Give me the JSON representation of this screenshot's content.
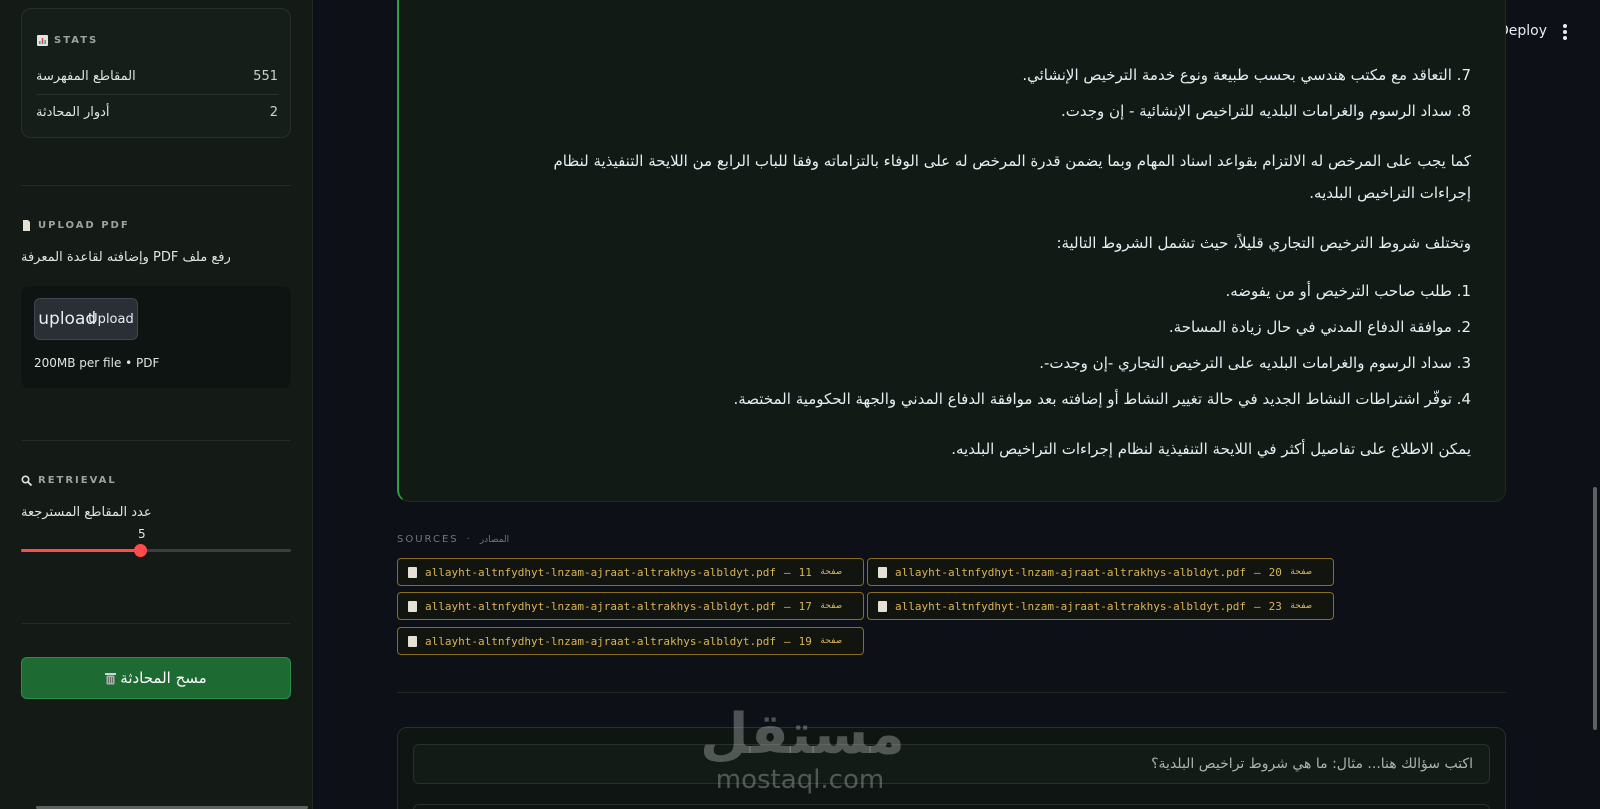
{
  "header": {
    "deploy_label": "Deploy"
  },
  "sidebar": {
    "stats": {
      "title": "STATS",
      "rows": [
        {
          "label": "المقاطع المفهرسة",
          "value": "551"
        },
        {
          "label": "أدوار المحادثة",
          "value": "2"
        }
      ]
    },
    "upload": {
      "title": "UPLOAD PDF",
      "description": "رفع ملف PDF وإضافته لقاعدة المعرفة",
      "button_icon_text": "upload",
      "button_label": "Upload",
      "note": "200MB per file • PDF"
    },
    "retrieval": {
      "title": "RETRIEVAL",
      "slider_label": "عدد المقاطع المسترجعة",
      "slider_value": "5",
      "slider_fraction": 0.44
    },
    "clear_button_label": "مسح المحادثة"
  },
  "message": {
    "lines": [
      "7. التعاقد مع مكتب هندسي بحسب طبيعة ونوع خدمة الترخيص الإنشائي.",
      "8. سداد الرسوم والغرامات البلديه للتراخيص الإنشائية - إن وجدت.",
      "كما يجب على المرخص له الالتزام بقواعد اسناد المهام وبما يضمن قدرة المرخص له على الوفاء بالتزاماته وفقا للباب الرابع من اللايحة التنفيذية لنظام",
      "إجراءات التراخيص البلديه.",
      "وتختلف شروط الترخيص التجاري قليلاً، حيث تشمل الشروط التالية:",
      "1. طلب صاحب الترخيص أو من يفوضه.",
      "2. موافقة الدفاع المدني في حال زيادة المساحة.",
      "3. سداد الرسوم والغرامات البلديه على الترخيص التجاري -إن وجدت-.",
      "4. توفّر اشتراطات النشاط الجديد في حالة تغيير النشاط أو إضافته بعد موافقة الدفاع المدني والجهة الحكومية المختصة.",
      "يمكن الاطلاع على تفاصيل أكثر في اللايحة التنفيذية لنظام إجراءات التراخيص البلديه."
    ]
  },
  "sources": {
    "label": "SOURCES",
    "separator": "·",
    "label_ar": "المصادر",
    "items": [
      {
        "file": "allayht-altnfydhyt-lnzam-ajraat-altrakhys-albldyt.pdf",
        "dash": "—",
        "page": "11",
        "page_label": "صفحة"
      },
      {
        "file": "allayht-altnfydhyt-lnzam-ajraat-altrakhys-albldyt.pdf",
        "dash": "—",
        "page": "20",
        "page_label": "صفحة"
      },
      {
        "file": "allayht-altnfydhyt-lnzam-ajraat-altrakhys-albldyt.pdf",
        "dash": "—",
        "page": "17",
        "page_label": "صفحة"
      },
      {
        "file": "allayht-altnfydhyt-lnzam-ajraat-altrakhys-albldyt.pdf",
        "dash": "—",
        "page": "23",
        "page_label": "صفحة"
      },
      {
        "file": "allayht-altnfydhyt-lnzam-ajraat-altrakhys-albldyt.pdf",
        "dash": "—",
        "page": "19",
        "page_label": "صفحة"
      }
    ]
  },
  "chat_input": {
    "placeholder": "اكتب سؤالك هنا... مثال: ما هي شروط تراخيص البلدية؟"
  },
  "watermark": {
    "ar": "مستقل",
    "en": "mostaql.com"
  },
  "colors": {
    "accent_green": "#2ea043",
    "slider_red": "#ff4b4b",
    "source_gold": "#d8b456"
  },
  "icons": {
    "stats": "bar-chart-icon",
    "upload": "document-icon",
    "retrieval": "magnifier-icon",
    "clear": "trash-icon",
    "menu": "kebab-menu-icon",
    "source": "document-icon"
  }
}
